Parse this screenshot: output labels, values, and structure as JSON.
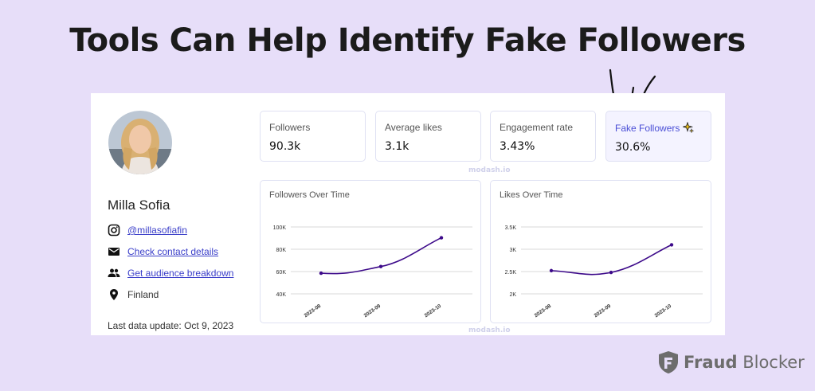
{
  "headline": "Tools Can Help Identify Fake Followers",
  "profile": {
    "name": "Milla Sofia",
    "instagram_handle": "@millasofiafin",
    "contact_link": "Check contact details",
    "audience_link": "Get audience breakdown",
    "location": "Finland",
    "last_update": "Last data update: Oct 9, 2023"
  },
  "stats": [
    {
      "label": "Followers",
      "value": "90.3k"
    },
    {
      "label": "Average likes",
      "value": "3.1k"
    },
    {
      "label": "Engagement rate",
      "value": "3.43%"
    },
    {
      "label": "Fake Followers",
      "value": "30.6%",
      "icon": "sparkle-icon"
    }
  ],
  "watermark": "modash.io",
  "chart_data": [
    {
      "type": "line",
      "title": "Followers Over Time",
      "categories": [
        "2023-08",
        "2023-09",
        "2023-10"
      ],
      "values": [
        58500,
        64500,
        90300
      ],
      "yticks": [
        "100K",
        "80K",
        "60K",
        "40K"
      ],
      "ytick_values": [
        100000,
        80000,
        60000,
        40000
      ],
      "ylim": [
        40000,
        100000
      ],
      "grid": true,
      "color": "#3d0a8a"
    },
    {
      "type": "line",
      "title": "Likes Over Time",
      "categories": [
        "2023-08",
        "2023-09",
        "2023-10"
      ],
      "values": [
        2520,
        2480,
        3100
      ],
      "yticks": [
        "3.5K",
        "3K",
        "2.5K",
        "2K"
      ],
      "ytick_values": [
        3500,
        3000,
        2500,
        2000
      ],
      "ylim": [
        2000,
        3500
      ],
      "grid": true,
      "color": "#3d0a8a"
    }
  ],
  "brand": {
    "bold": "Fraud",
    "rest": "Blocker"
  },
  "colors": {
    "background": "#e7def9",
    "accent": "#4a4ed6",
    "line": "#3d0a8a"
  }
}
